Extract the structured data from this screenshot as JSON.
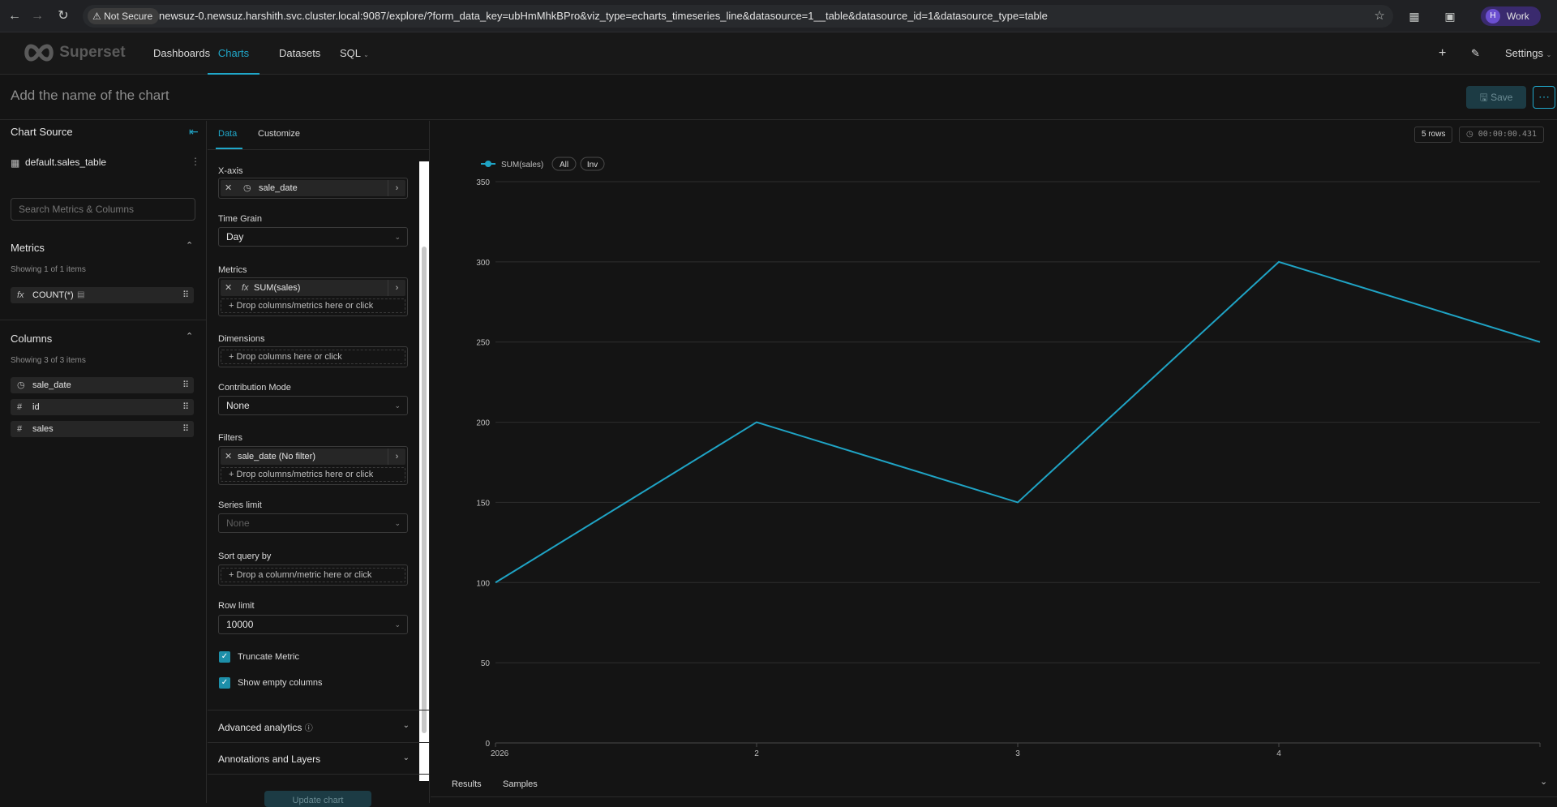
{
  "browser": {
    "not_secure": "Not Secure",
    "url": "newsuz-0.newsuz.harshith.svc.cluster.local:9087/explore/?form_data_key=ubHmMhkBPro&viz_type=echarts_timeseries_line&datasource=1__table&datasource_id=1&datasource_type=table",
    "profile_initial": "H",
    "profile_label": "Work"
  },
  "nav": {
    "brand": "Superset",
    "items": [
      "Dashboards",
      "Charts",
      "Datasets",
      "SQL"
    ],
    "active": "Charts",
    "settings": "Settings"
  },
  "header": {
    "chart_name_placeholder": "Add the name of the chart",
    "save_label": "Save"
  },
  "datasource": {
    "section_title": "Chart Source",
    "name": "default.sales_table",
    "search_placeholder": "Search Metrics & Columns",
    "metrics_title": "Metrics",
    "metrics_count": "Showing 1 of 1 items",
    "metrics": [
      {
        "icon": "fx",
        "name": "COUNT(*)"
      }
    ],
    "columns_title": "Columns",
    "columns_count": "Showing 3 of 3 items",
    "columns": [
      {
        "icon": "clock-icon",
        "name": "sale_date"
      },
      {
        "icon": "hash-icon",
        "name": "id"
      },
      {
        "icon": "hash-icon",
        "name": "sales"
      }
    ]
  },
  "controls": {
    "tabs": [
      "Data",
      "Customize"
    ],
    "active_tab": "Data",
    "xaxis_label": "X-axis",
    "xaxis_value": "sale_date",
    "time_grain_label": "Time Grain",
    "time_grain_value": "Day",
    "metrics_label": "Metrics",
    "metrics_value": "SUM(sales)",
    "drop_cols_metrics": "Drop columns/metrics here or click",
    "dimensions_label": "Dimensions",
    "drop_cols": "Drop columns here or click",
    "contribution_label": "Contribution Mode",
    "contribution_value": "None",
    "filters_label": "Filters",
    "filters_value": "sale_date (No filter)",
    "series_limit_label": "Series limit",
    "series_limit_value": "None",
    "sort_label": "Sort query by",
    "sort_drop": "Drop a column/metric here or click",
    "row_limit_label": "Row limit",
    "row_limit_value": "10000",
    "truncate_metric": "Truncate Metric",
    "show_empty": "Show empty columns",
    "advanced": "Advanced analytics",
    "annotations": "Annotations and Layers",
    "update_btn": "Update chart"
  },
  "results": {
    "rows": "5 rows",
    "duration": "00:00:00.431",
    "tab_results": "Results",
    "tab_samples": "Samples"
  },
  "chart_data": {
    "type": "line",
    "x": [
      "2026",
      "2",
      "3",
      "4",
      ""
    ],
    "series": [
      {
        "name": "SUM(sales)",
        "values": [
          100,
          200,
          150,
          300,
          250
        ]
      }
    ],
    "ylim": [
      0,
      350
    ],
    "yticks": [
      0,
      50,
      100,
      150,
      200,
      250,
      300,
      350
    ],
    "legend_buttons": [
      "All",
      "Inv"
    ],
    "color": "#1fa3c4",
    "grid": true
  }
}
